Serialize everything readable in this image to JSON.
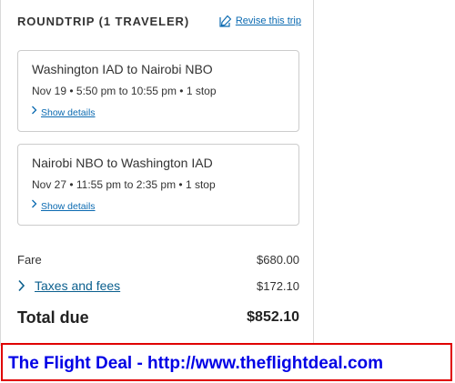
{
  "trip": {
    "title": "ROUNDTRIP (1 TRAVELER)",
    "revise_label": "Revise this trip",
    "edit_icon": "edit-icon"
  },
  "flights": [
    {
      "route": "Washington IAD to Nairobi NBO",
      "times": "Nov 19 • 5:50 pm to 10:55 pm • 1 stop",
      "details_label": "Show details"
    },
    {
      "route": "Nairobi NBO to Washington IAD",
      "times": "Nov 27 • 11:55 pm to 2:35 pm • 1 stop",
      "details_label": "Show details"
    }
  ],
  "pricing": {
    "fare_label": "Fare",
    "fare_value": "$680.00",
    "taxes_label": "Taxes and fees",
    "taxes_value": "$172.10",
    "total_label": "Total due",
    "total_value": "$852.10"
  },
  "banner": {
    "text": "The Flight Deal - http://www.theflightdeal.com"
  },
  "colors": {
    "link": "#0b6ab1",
    "banner_border": "#e00000",
    "banner_text": "#0000e6"
  }
}
